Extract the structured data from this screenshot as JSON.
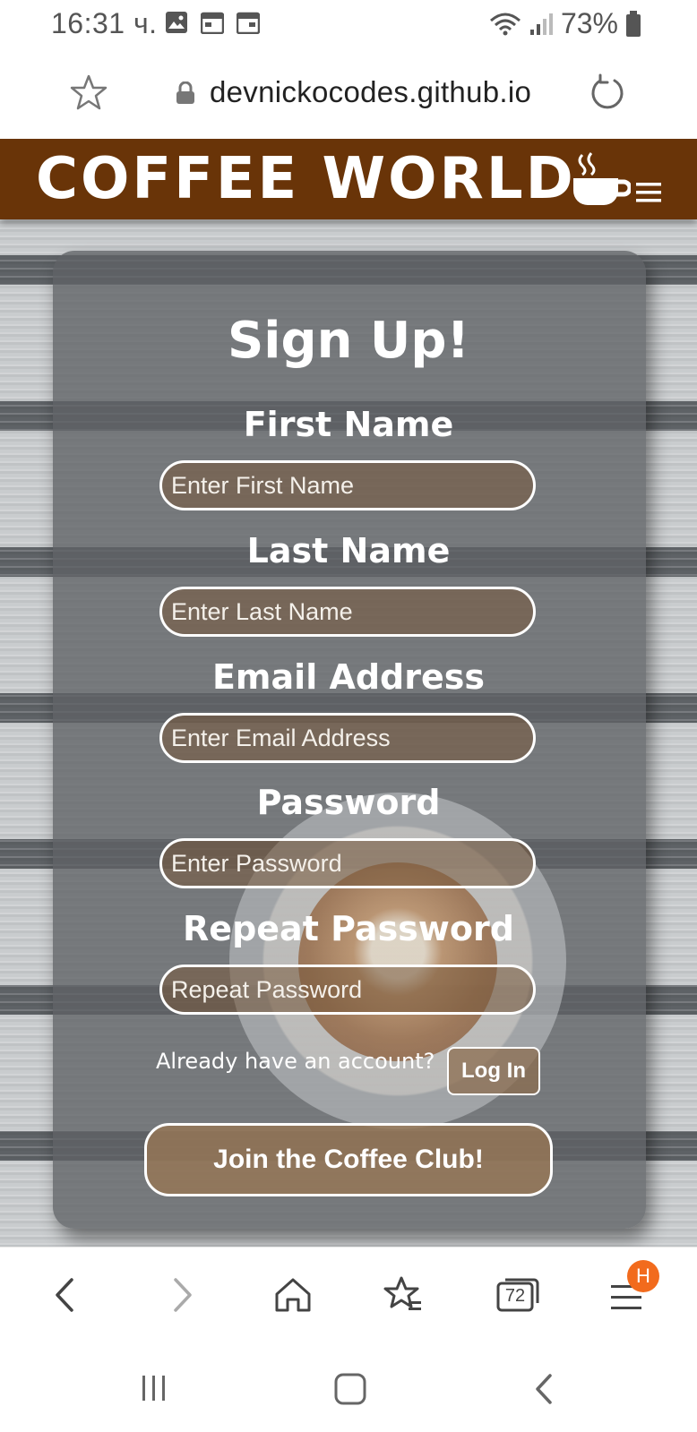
{
  "status_bar": {
    "time": "16:31 ч.",
    "battery": "73%"
  },
  "browser": {
    "url": "devnickocodes.github.io",
    "tab_count": "72",
    "menu_badge": "H"
  },
  "site": {
    "title": "COFFEE WORLD"
  },
  "form": {
    "title": "Sign Up!",
    "fields": [
      {
        "label": "First Name",
        "placeholder": "Enter First Name"
      },
      {
        "label": "Last Name",
        "placeholder": "Enter Last Name"
      },
      {
        "label": "Email Address",
        "placeholder": "Enter Email Address"
      },
      {
        "label": "Password",
        "placeholder": "Enter Password"
      },
      {
        "label": "Repeat Password",
        "placeholder": "Repeat Password"
      }
    ],
    "login_prompt": "Already have an account?",
    "login_button": "Log In",
    "submit_button": "Join the Coffee Club!"
  },
  "colors": {
    "header_bg": "#693408",
    "badge": "#f26b1d"
  }
}
